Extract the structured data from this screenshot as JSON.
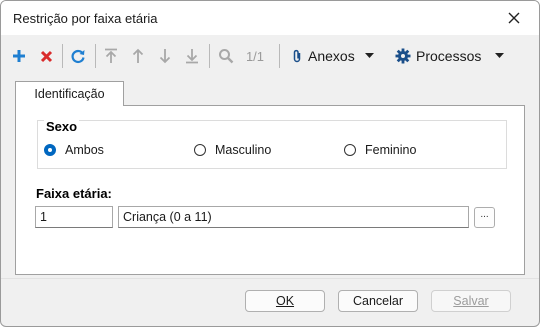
{
  "window": {
    "title": "Restrição por faixa etária"
  },
  "toolbar": {
    "pager": "1/1",
    "attachments_label": "Anexos",
    "processes_label": "Processos"
  },
  "tabs": [
    {
      "label": "Identificação"
    }
  ],
  "sex_group": {
    "title": "Sexo",
    "options": [
      {
        "label": "Ambos",
        "selected": true
      },
      {
        "label": "Masculino",
        "selected": false
      },
      {
        "label": "Feminino",
        "selected": false
      }
    ]
  },
  "age_range": {
    "label": "Faixa etária:",
    "code": "1",
    "description": "Criança (0 a 11)",
    "lookup_label": "..."
  },
  "buttons": {
    "ok": "OK",
    "cancel": "Cancelar",
    "save": "Salvar"
  },
  "colors": {
    "add": "#1f7fd1",
    "delete": "#d92b2b",
    "refresh": "#1f7fd1",
    "radio_selected": "#0067c0",
    "disabled_icon": "#a8a8a8"
  }
}
